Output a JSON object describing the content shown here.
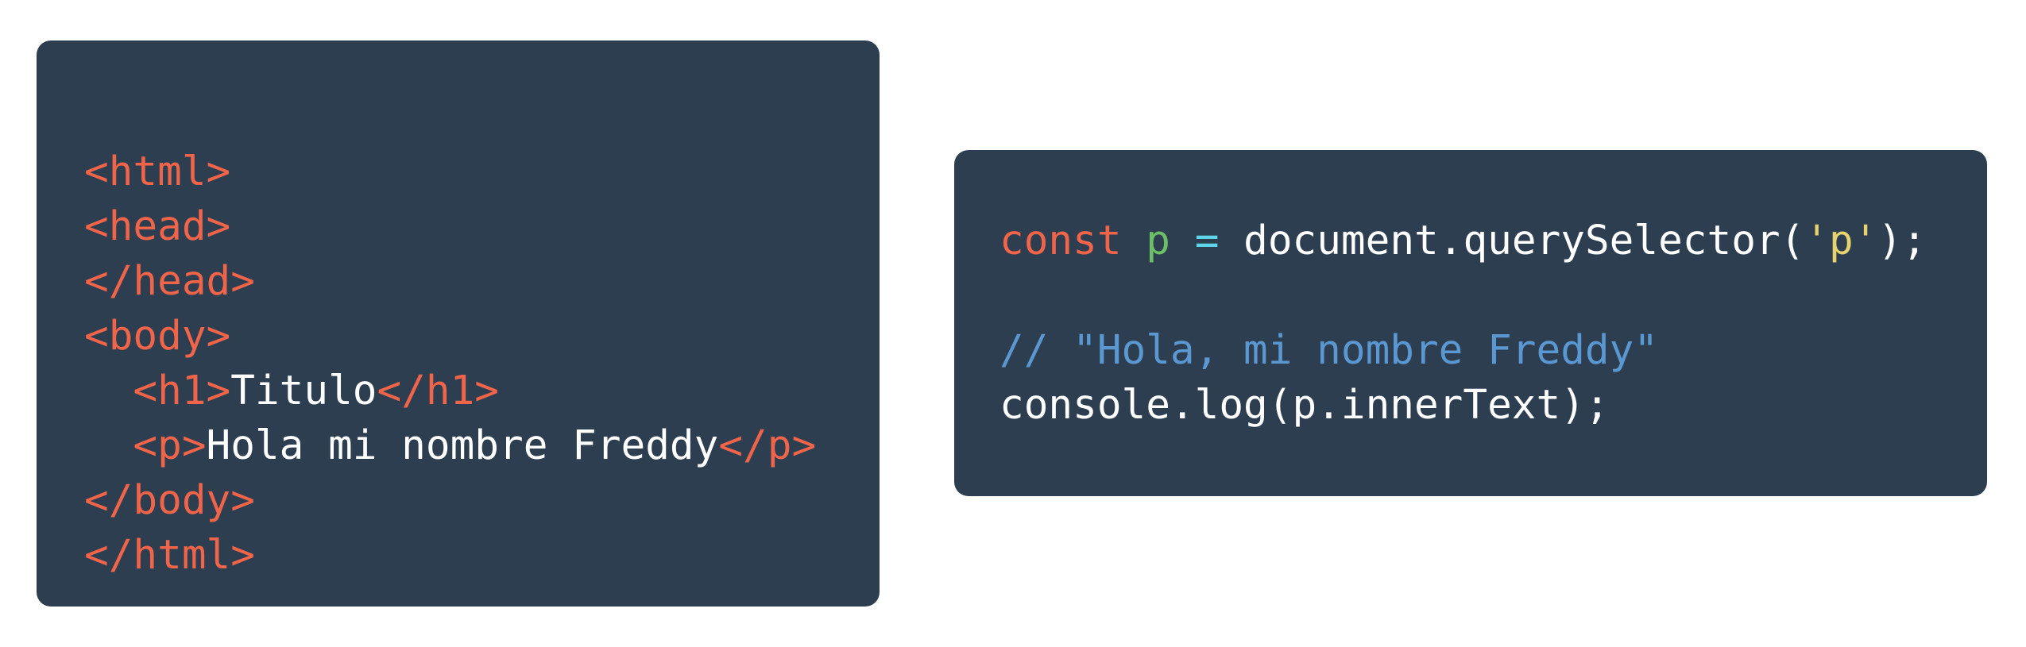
{
  "colors": {
    "panel_bg": "#2c3e50",
    "tag": "#f06449",
    "text": "#ffffff",
    "keyword": "#f06449",
    "variable": "#6dbf67",
    "operator": "#5fd3e8",
    "string": "#e6d36f",
    "comment": "#5b98d2"
  },
  "html_snippet": {
    "line1": {
      "tag": "<html>"
    },
    "line2": {
      "tag": "<head>"
    },
    "line3": {
      "tag": "</head>"
    },
    "line4": {
      "tag": "<body>"
    },
    "line5": {
      "indent": "  ",
      "open": "<h1>",
      "text": "Titulo",
      "close": "</h1>"
    },
    "line6": {
      "indent": "  ",
      "open": "<p>",
      "text": "Hola mi nombre Freddy",
      "close": "</p>"
    },
    "line7": {
      "tag": "</body>"
    },
    "line8": {
      "tag": "</html>"
    }
  },
  "js_snippet": {
    "line1": {
      "keyword": "const",
      "sp1": " ",
      "variable": "p",
      "sp2": " ",
      "operator": "=",
      "code_before_string": " document.querySelector(",
      "string": "'p'",
      "code_after_string": ");"
    },
    "line2": {
      "comment": "// \"Hola, mi nombre Freddy\""
    },
    "line3": {
      "code": "console.log(p.innerText);"
    }
  }
}
